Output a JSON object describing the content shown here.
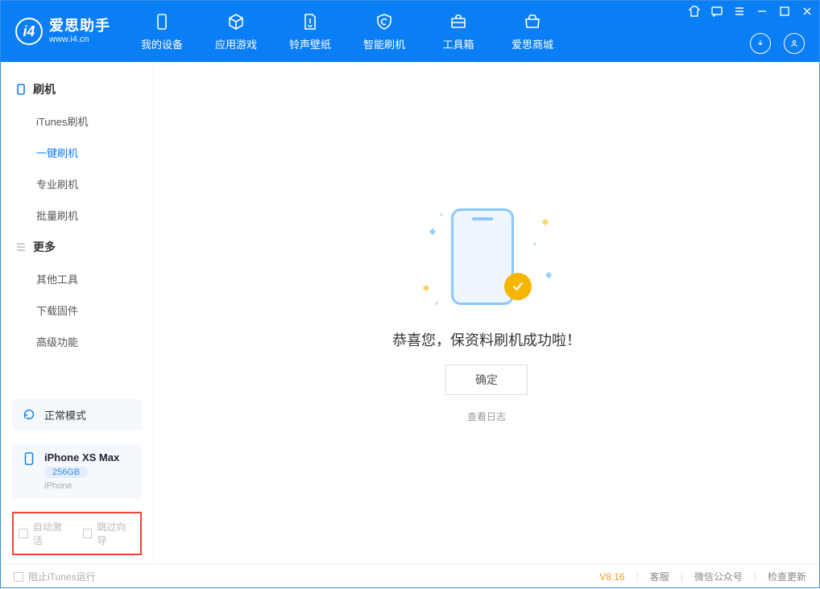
{
  "app": {
    "name_cn": "爱思助手",
    "name_en": "www.i4.cn"
  },
  "nav": {
    "device": "我的设备",
    "apps": "应用游戏",
    "rings": "铃声壁纸",
    "flash": "智能刷机",
    "toolbox": "工具箱",
    "store": "爱思商城"
  },
  "sidebar": {
    "group_flash": "刷机",
    "items_flash": [
      "iTunes刷机",
      "一键刷机",
      "专业刷机",
      "批量刷机"
    ],
    "group_more": "更多",
    "items_more": [
      "其他工具",
      "下载固件",
      "高级功能"
    ]
  },
  "mode": {
    "label": "正常模式"
  },
  "device": {
    "name": "iPhone XS Max",
    "storage": "256GB",
    "type": "iPhone"
  },
  "checks": {
    "auto_activate": "自动激活",
    "skip_guide": "跳过向导"
  },
  "main": {
    "success_text": "恭喜您，保资料刷机成功啦！",
    "ok": "确定",
    "view_log": "查看日志"
  },
  "footer": {
    "block_itunes": "阻止iTunes运行",
    "version": "V8.16",
    "customer_service": "客服",
    "wechat": "微信公众号",
    "check_update": "检查更新"
  }
}
